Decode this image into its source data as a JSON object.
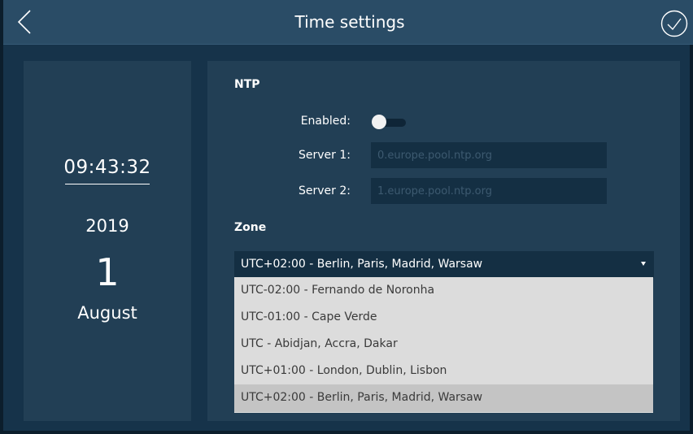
{
  "header": {
    "title": "Time settings"
  },
  "datetime": {
    "time": "09:43:32",
    "year": "2019",
    "day": "1",
    "month": "August"
  },
  "ntp": {
    "section_title": "NTP",
    "enabled_label": "Enabled:",
    "enabled": false,
    "server1_label": "Server 1:",
    "server1_placeholder": "0.europe.pool.ntp.org",
    "server2_label": "Server 2:",
    "server2_placeholder": "1.europe.pool.ntp.org"
  },
  "zone": {
    "section_title": "Zone",
    "selected": "UTC+02:00 - Berlin, Paris, Madrid, Warsaw",
    "options": [
      "UTC-02:00 - Fernando de Noronha",
      "UTC-01:00 - Cape Verde",
      "UTC - Abidjan, Accra, Dakar",
      "UTC+01:00 - London, Dublin, Lisbon",
      "UTC+02:00 - Berlin, Paris, Madrid, Warsaw"
    ],
    "selected_index": 4
  },
  "icons": {
    "back": "chevron-left-icon",
    "confirm": "check-circle-icon"
  },
  "colors": {
    "background": "#16334a",
    "topbar": "#2a4c66",
    "panel": "#223f55",
    "input": "#142f43",
    "dropdown": "#dcdcdc",
    "dropdown_selected": "#c4c4c4"
  }
}
